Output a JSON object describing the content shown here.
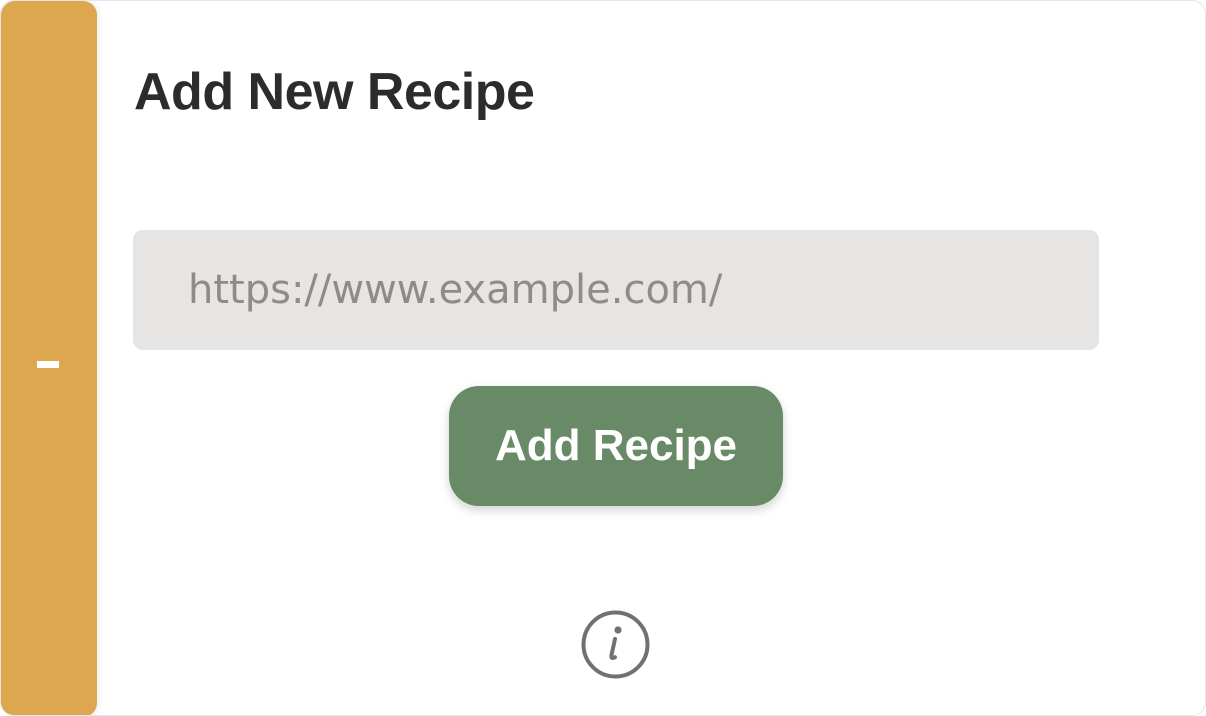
{
  "sidebar": {
    "icon": "minus-icon",
    "accent_color": "#DDA74F"
  },
  "header": {
    "title": "Add New Recipe"
  },
  "form": {
    "url_input": {
      "value": "",
      "placeholder": "https://www.example.com/"
    },
    "submit_label": "Add Recipe",
    "submit_color": "#688A66"
  },
  "footer": {
    "info_icon": "info-icon"
  }
}
